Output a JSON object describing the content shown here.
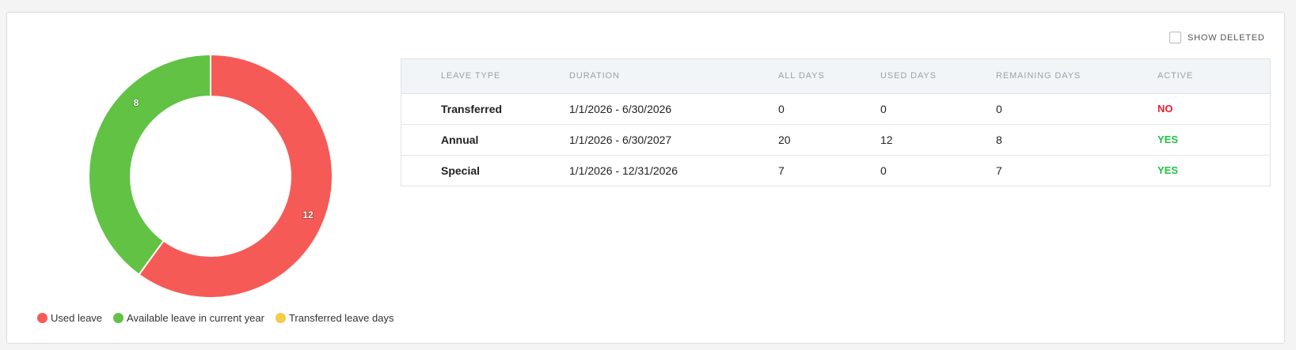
{
  "chart_data": {
    "type": "pie",
    "variant": "doughnut",
    "slices": [
      {
        "name": "Used leave",
        "value": 12,
        "color": "#f65a56"
      },
      {
        "name": "Available leave in current year",
        "value": 8,
        "color": "#61c244"
      },
      {
        "name": "Transferred leave days",
        "value": 0,
        "color": "#f5cb47"
      }
    ],
    "legend_position": "bottom"
  },
  "legend": {
    "items": [
      {
        "label": "Used leave",
        "color": "#f65a56"
      },
      {
        "label": "Available leave in current year",
        "color": "#61c244"
      },
      {
        "label": "Transferred leave days",
        "color": "#f5cb47"
      }
    ]
  },
  "controls": {
    "show_deleted_label": "SHOW DELETED",
    "show_deleted_checked": false
  },
  "table": {
    "headers": {
      "leave_type": "LEAVE TYPE",
      "duration": "DURATION",
      "all_days": "ALL DAYS",
      "used_days": "USED DAYS",
      "remaining_days": "REMAINING DAYS",
      "active": "ACTIVE"
    },
    "rows": [
      {
        "leave_type": "Transferred",
        "duration": "1/1/2026 - 6/30/2026",
        "all_days": "0",
        "used_days": "0",
        "remaining_days": "0",
        "active": "NO"
      },
      {
        "leave_type": "Annual",
        "duration": "1/1/2026 - 6/30/2027",
        "all_days": "20",
        "used_days": "12",
        "remaining_days": "8",
        "active": "YES"
      },
      {
        "leave_type": "Special",
        "duration": "1/1/2026 - 12/31/2026",
        "all_days": "7",
        "used_days": "0",
        "remaining_days": "7",
        "active": "YES"
      }
    ]
  }
}
